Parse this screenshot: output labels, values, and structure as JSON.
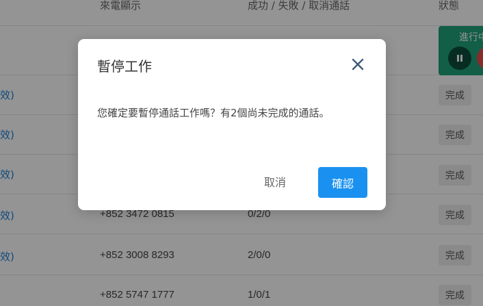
{
  "table": {
    "headers": {
      "caller_id": "來電顯示",
      "result": "成功 / 失敗 / 取消通話",
      "status": "狀態"
    },
    "progress": {
      "label": "進行中"
    },
    "rows": [
      {
        "link": "效)",
        "phone": "",
        "result": "",
        "status": "完成"
      },
      {
        "link": "效)",
        "phone": "",
        "result": "",
        "status": "完成"
      },
      {
        "link": "效)",
        "phone": "",
        "result": "",
        "status": "完成"
      },
      {
        "link": "效)",
        "phone": "+852 3472 0815",
        "result": "0/2/0",
        "status": "完成"
      },
      {
        "link": "效)",
        "phone": "+852 3008 8293",
        "result": "2/0/0",
        "status": "完成"
      },
      {
        "link": "",
        "phone": "+852 5747 1777",
        "result": "1/0/1",
        "status": "完成"
      }
    ]
  },
  "dialog": {
    "title": "暫停工作",
    "message": "您確定要暫停通話工作嗎？有2個尚未完成的通話。",
    "cancel_label": "取消",
    "confirm_label": "確認"
  },
  "colors": {
    "accent": "#1a91f0",
    "progress_bg": "#1fa37a",
    "link": "#1a7fd6"
  }
}
